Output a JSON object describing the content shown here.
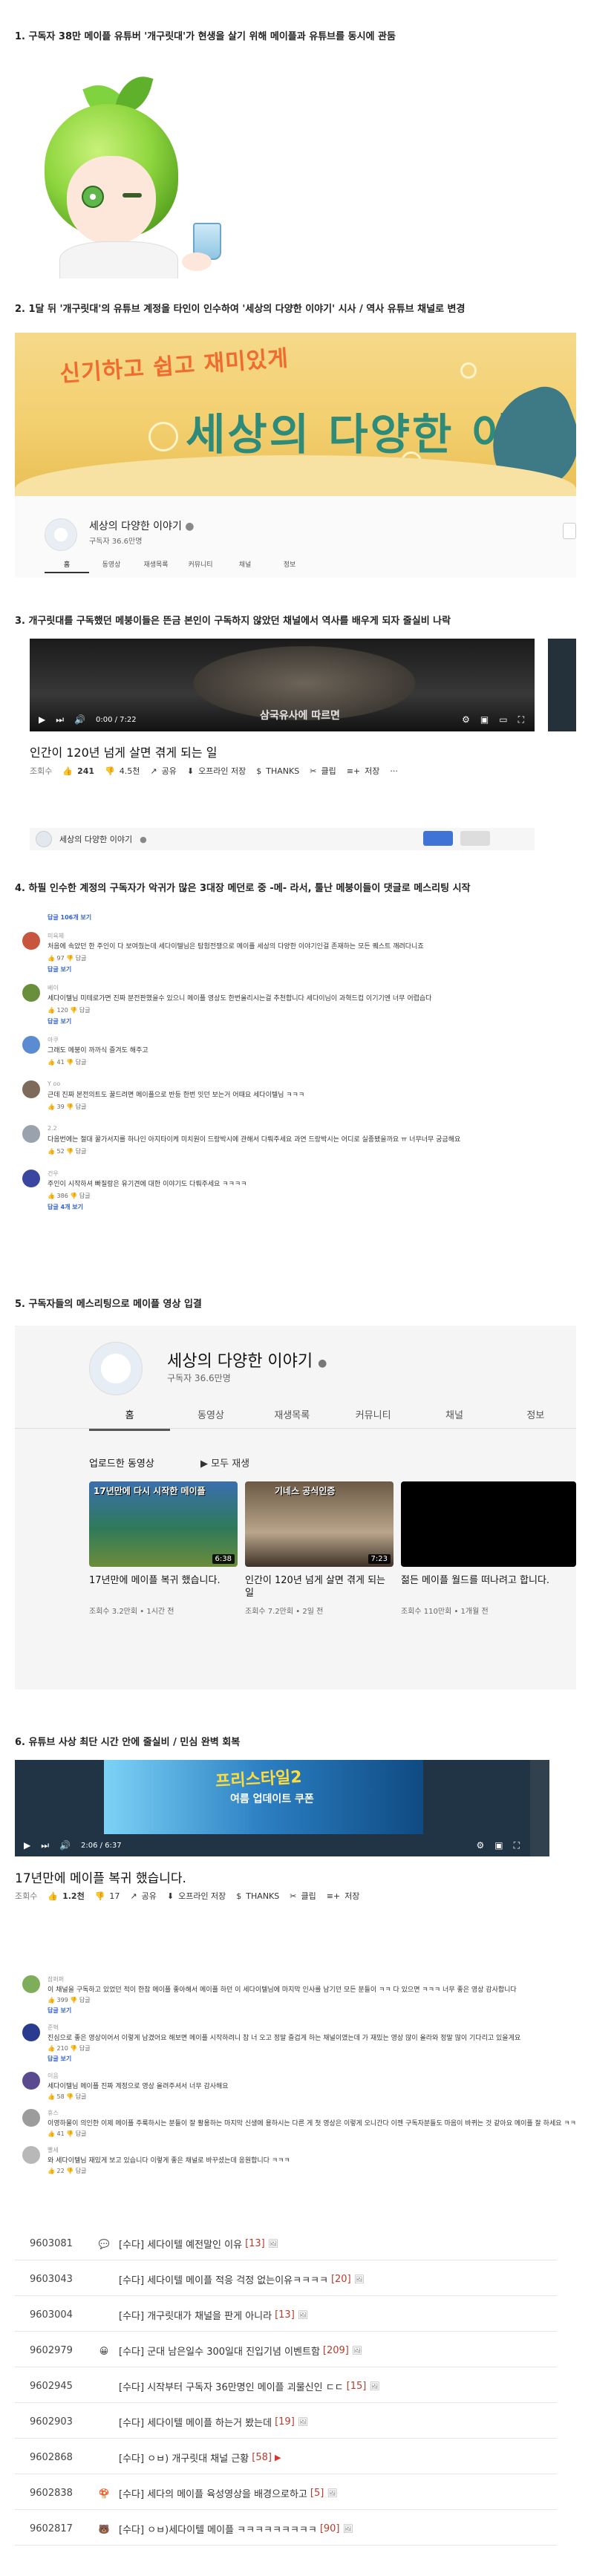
{
  "sections": {
    "s1": "1. 구독자 38만 메이플 유튜버 '개구릿대'가 현생을 살기 위해 메이플과 유튜브를 동시에 관둠",
    "s2": "2. 1달 뒤 '개구릿대'의 유튜브 계정을 타인이 인수하여 '세상의 다양한 이야기' 시사 / 역사 유튜브 채널로 변경",
    "s3": "3. 개구릿대를 구독했던 메붕이들은 뜬금 본인이 구독하지 않았던 채널에서 역사를 배우게 되자 줄실비 나락",
    "s4": "4. 하필 인수한 계정의 구독자가 악귀가 많은 3대장 메던로 중 -메- 라서, 툴난 메붕이들이 댓글로 메스리팅 시작",
    "s5": "5. 구독자들의 메스리팅으로 메이플 영상 입결",
    "s6": "6. 유튜브 사상 최단 시간 안에 줄실비 / 민심 완벽 회복"
  },
  "banner": {
    "subtitle": "신기하고 쉽고 재미있게",
    "title": "세상의 다양한 이야기",
    "channel_name": "세상의 다양한 이야기",
    "subs": "구독자 36.6만명",
    "tabs": [
      "홈",
      "동영상",
      "재생목록",
      "커뮤니티",
      "채널",
      "정보"
    ]
  },
  "video3": {
    "time": "0:00 / 7:22",
    "caption": "삼국유사에 따르면",
    "title": "인간이 120년 넘게 살면 겪게 되는 일",
    "views": "조회수",
    "likes": "241",
    "dislikes": "4.5천",
    "share": "공유",
    "save_offline": "오프라인 저장",
    "thanks": "THANKS",
    "clip": "클립",
    "save": "저장",
    "more": "···",
    "channel": "세상의 다양한 이야기"
  },
  "comments4": [
    {
      "reply": "답글 106개 보기"
    },
    {
      "name": "미육체",
      "text": "처음에 속았던 한 주인이 다 보여줬는데 세다이텔님은 탐험전쟁으로 메이플 세상의 다양한 이야기인걸 존재하는 모든 퀘스트 깨려다니죠",
      "likes": "97",
      "reply": "답글 보기"
    },
    {
      "name": "베이",
      "text": "세다이텔님 미테로가면 진짜 분전판했을수 있으니 메이플 영상도 한번올리시는걸 추천합니다 세다이님이 과혁드컵 이기기엔 너무 어렵습다",
      "likes": "120",
      "reply": "답글 보기"
    },
    {
      "name": "아쿠",
      "text": "그래도 메붕이 까까식 즐겨도 해주고",
      "likes": "41"
    },
    {
      "name": "Y oo",
      "text": "근데 진짜 본전의트도 꿀드려면 메이플으로 반등 한번 잇던 보는거 어때요 세다이텔님 ㅋㅋㅋ",
      "likes": "39"
    },
    {
      "name": "2.2",
      "text": "다음번에는 절대 꿀가서지를 하나인 아지타이케 미치원이 드랑박시에 관해서 다뤄주세요 과연 드랑박시는 어디로 실종됐을까요 ㅠ 너무너무 궁금해요",
      "likes": "52"
    },
    {
      "name": "건우",
      "text": "주인이 시작하셔 빠질랑은 유기견에 대한 이야기도 다뤄주세요 ㅋㅋㅋㅋ",
      "likes": "386",
      "reply": "답글 4개 보기"
    }
  ],
  "channel5": {
    "name": "세상의 다양한 이야기",
    "subs": "구독자 36.6만명",
    "tabs": [
      "홈",
      "동영상",
      "재생목록",
      "커뮤니티",
      "채널",
      "정보"
    ],
    "uploaded": "업로드한 동영상",
    "play_all": "모두 재생",
    "videos": [
      {
        "title": "17년만에 메이플 복귀 했습니다.",
        "meta": "조회수 3.2만회 • 1시간 전",
        "duration": "6:38",
        "thumb_text": "17년만에 다시 시작한 메이플"
      },
      {
        "title": "인간이 120년 넘게 살면 겪게 되는 일",
        "meta": "조회수 7.2만회 • 2일 전",
        "duration": "7:23",
        "thumb_text": "기네스 공식인증"
      },
      {
        "title": "젊든 메이플 월드를 떠나려고 합니다.",
        "meta": "조회수 110만회 • 1개월 전",
        "duration": ""
      }
    ]
  },
  "video6": {
    "ad_text": "프리스타일2",
    "ad_text2": "여름 업데이트 쿠폰",
    "time": "2:06 / 6:37",
    "title": "17년만에 메이플 복귀 했습니다.",
    "views": "조회수",
    "likes": "1.2천",
    "dislikes": "17",
    "share": "공유",
    "save_offline": "오프라인 저장",
    "thanks": "THANKS",
    "clip": "클립",
    "save": "저장"
  },
  "comments6": [
    {
      "name": "잠퍼퍼",
      "text": "이 채널을 구독하고 있었던 적이 한참 메이플 좋아해서 메이플 하던 이 세다이텔님에 마지막 인사를 남기던 모든 분들이 ㅋㅋ 다 있으면 ㅋㅋㅋ 너무 좋은 영상 감사합니다",
      "likes": "399",
      "reply": "답글 보기"
    },
    {
      "name": "준혁",
      "text": "진심으로 좋은 영상이어서 이렇게 남겼어요 해보면 메이플 시작하려니 참 너 오고 정말 즐겁게 하는 채널이였는데 가 재밌는 영상 많이 올라와 정말 많이 기다리고 있을게요",
      "likes": "210",
      "reply": "답글 보기"
    },
    {
      "name": "이음",
      "text": "세다이텔님 메이플 진짜 계정으로 영상 올려주셔서 너무 감사해요",
      "likes": "58"
    },
    {
      "name": "휴스",
      "text": "이영하물이 의인한 이제 메이플 주룩하시는 분들이 잘 활용하는 마지막 신생에 용하시는 다른 게 첫 영상은 이렇게 오니간다 이젠 구독자분들도 마음이 바뀌는 것 같아요 메이플 잘 하세요 ㅋㅋㅋ",
      "likes": "41"
    },
    {
      "name": "빨세",
      "text": "와 세다이텔님 재밌게 보고 있습니다 이렇게 좋은 채널로 바꾸셨는데 응원합니다 ㅋㅋㅋ",
      "likes": "22"
    }
  ],
  "board": [
    {
      "num": "9603081",
      "icon": "💬",
      "title": "[수다] 세다이텔 예전말인 이유",
      "count": "[13]",
      "img": "🖼"
    },
    {
      "num": "9603043",
      "icon": "",
      "title": "[수다] 세다이텔 메이플 적응 걱정 없는이유ㅋㅋㅋㅋ",
      "count": "[20]",
      "img": "🖼"
    },
    {
      "num": "9603004",
      "icon": "",
      "title": "[수다] 개구릿대가 채널을 판게 아니라",
      "count": "[13]",
      "img": "🖼"
    },
    {
      "num": "9602979",
      "icon": "😀",
      "title": "[수다] 군대 남은일수 300일대 진입기념 이벤트함",
      "count": "[209]",
      "img": "🖼"
    },
    {
      "num": "9602945",
      "icon": "",
      "title": "[수다] 시작부터 구독자 36만명인 메이플 괴물신인 ㄷㄷ",
      "count": "[15]",
      "img": "🖼"
    },
    {
      "num": "9602903",
      "icon": "",
      "title": "[수다] 세다이텔 메이플 하는거 봤는데",
      "count": "[19]",
      "img": "🖼"
    },
    {
      "num": "9602868",
      "icon": "",
      "title": "[수다] ㅇㅂ) 개구릿대 채널 근황",
      "count": "[58]",
      "img": "▶"
    },
    {
      "num": "9602838",
      "icon": "🍄",
      "title": "[수다] 세다의 메이플 육성영상을 배경으로하고",
      "count": "[5]",
      "img": "🖼"
    },
    {
      "num": "9602817",
      "icon": "🐻",
      "title": "[수다] ㅇㅂ)세다이텔 메이플 ㅋㅋㅋㅋㅋㅋㅋㅋㅋ",
      "count": "[90]",
      "img": "🖼"
    }
  ]
}
